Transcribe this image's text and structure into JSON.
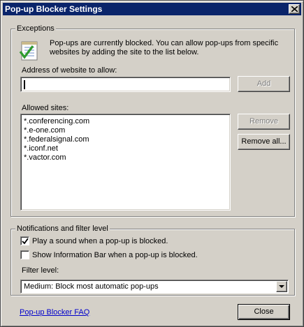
{
  "window": {
    "title": "Pop-up Blocker Settings"
  },
  "exceptions": {
    "group_title": "Exceptions",
    "info_line1": "Pop-ups are currently blocked.  You can allow pop-ups from specific",
    "info_line2": "websites by adding the site to the list below.",
    "address_label": "Address of website to allow:",
    "address_value": "",
    "add_button": "Add",
    "allowed_label": "Allowed sites:",
    "allowed_sites": [
      "*.conferencing.com",
      "*.e-one.com",
      "*.federalsignal.com",
      "*.iconf.net",
      "*.vactor.com"
    ],
    "remove_button": "Remove",
    "remove_all_button": "Remove all..."
  },
  "notifications": {
    "group_title": "Notifications and filter level",
    "play_sound_label": "Play a sound when a pop-up is blocked.",
    "play_sound_checked": true,
    "info_bar_label": "Show Information Bar when a pop-up is blocked.",
    "info_bar_checked": false,
    "filter_level_label": "Filter level:",
    "filter_level_value": "Medium: Block most automatic pop-ups"
  },
  "footer": {
    "faq_link": "Pop-up Blocker FAQ",
    "close_button": "Close"
  },
  "icons": {
    "info_icon": "checklist-icon",
    "checkmark": "checkmark-icon",
    "dropdown": "chevron-down-icon",
    "close": "close-icon"
  }
}
